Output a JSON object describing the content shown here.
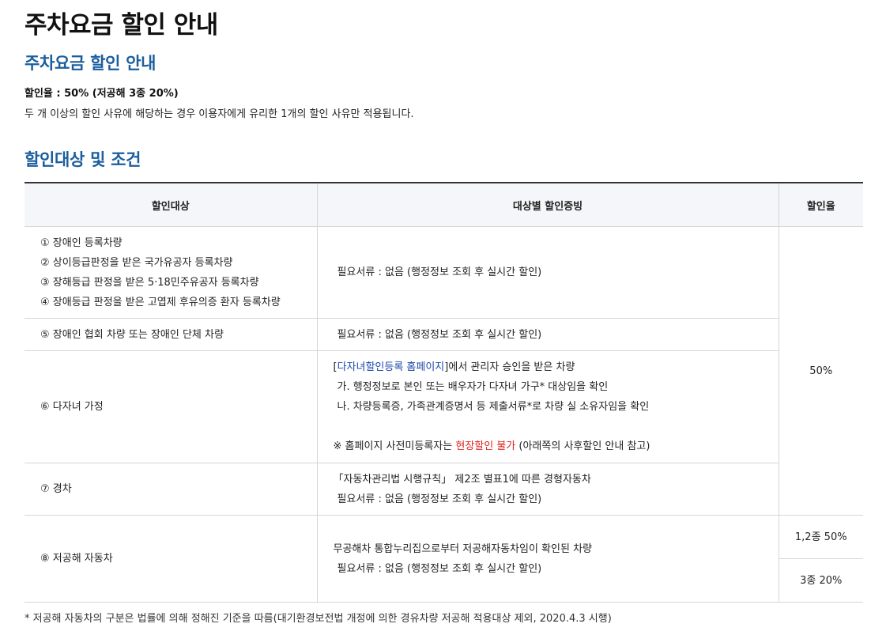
{
  "page": {
    "title": "주차요금 할인 안내",
    "subtitle": "주차요금 할인 안내",
    "rate_line": "할인율 : 50% (저공해 3종 20%)",
    "rate_note": "두 개 이상의 할인 사유에 해당하는 경우 이용자에게 유리한 1개의 할인 사유만 적용됩니다.",
    "conditions_title": "할인대상 및 조건"
  },
  "table": {
    "headers": [
      "할인대상",
      "대상별 할인증빙",
      "할인율"
    ],
    "row1": {
      "targets": [
        "① 장애인 등록차량",
        "② 상이등급판정을 받은 국가유공자 등록차량",
        "③ 장해등급 판정을 받은 5·18민주유공자 등록차량",
        "④ 장애등급 판정을 받은 고엽제 후유의증 환자 등록차량"
      ],
      "proof": "필요서류 : 없음 (행정정보 조회 후 실시간 할인)"
    },
    "row2": {
      "target": "⑤ 장애인 협회 차량 또는 장애인 단체 차량",
      "proof": "필요서류 : 없음 (행정정보 조회 후 실시간 할인)"
    },
    "row3": {
      "target": "⑥ 다자녀 가정",
      "proof_link_open": "[",
      "proof_link": "다자녀할인등록 홈페이지",
      "proof_link_rest": "]에서 관리자 승인을 받은 차량",
      "proof_a": "가. 행정정보로 본인 또는 배우자가 다자녀 가구* 대상임을 확인",
      "proof_b": "나. 차량등록증, 가족관계증명서 등 제출서류*로 차량 실 소유자임을 확인",
      "note_prefix": "※ 홈페이지 사전미등록자는 ",
      "note_red": "현장할인 불가",
      "note_suffix": " (아래쪽의 사후할인 안내 참고)"
    },
    "row4": {
      "target": "⑦ 경차",
      "proof_1": "「자동차관리법 시행규칙」 제2조 별표1에 따른 경형자동차",
      "proof_2": "필요서류 : 없음 (행정정보 조회 후 실시간 할인)"
    },
    "row5": {
      "target": "⑧ 저공해 자동차",
      "proof_1": "무공해차 통합누리집으로부터 저공해자동차임이 확인된 차량",
      "proof_2": "필요서류 : 없음 (행정정보 조회 후 실시간 할인)",
      "rate_a": "1,2종 50%",
      "rate_b": "3종 20%"
    },
    "rate_main": "50%"
  },
  "footnote": "* 저공해 자동차의 구분은 법률에 의해 정해진 기준을 따름(대기환경보전법 개정에 의한 경유차량 저공해 적용대상 제외, 2020.4.3 시행)",
  "colors": {
    "section_title": "#1b5e9e",
    "link": "#1c48a8",
    "warning": "#e0201b",
    "header_bg": "#f4f6f9"
  }
}
